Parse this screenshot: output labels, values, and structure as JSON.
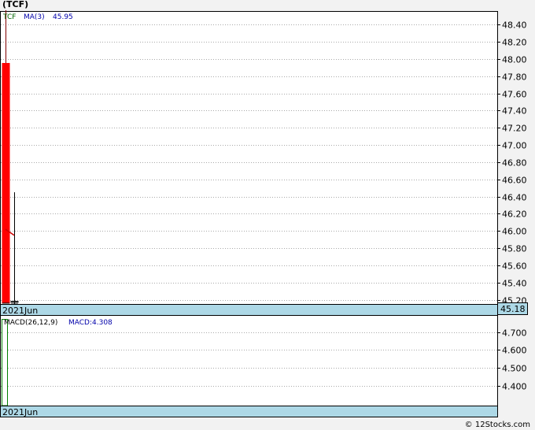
{
  "header": {
    "title": "(TCF)",
    "footer": "© 12Stocks.com"
  },
  "colors": {
    "up": "#008000",
    "down": "#ff0000",
    "ma": "#cc0000",
    "axis_band": "#add8e6",
    "legend_blue": "#0000aa",
    "legend_green": "#006400"
  },
  "chart_data": [
    {
      "type": "candlestick",
      "legend": {
        "symbol": "TCF",
        "ma_label": "MA(3)",
        "ma_value": "45.95"
      },
      "ylim": [
        45.15,
        48.55
      ],
      "yticks": [
        "48.40",
        "48.20",
        "48.00",
        "47.80",
        "47.60",
        "47.40",
        "47.20",
        "47.00",
        "46.80",
        "46.60",
        "46.40",
        "46.20",
        "46.00",
        "45.80",
        "45.60",
        "45.40",
        "45.20"
      ],
      "x_label": "2021Jun",
      "last_price": "45.18",
      "candles": [
        {
          "open": 47.95,
          "high": 48.57,
          "low": 45.16,
          "close": 45.16
        },
        {
          "open": 45.17,
          "high": 46.45,
          "low": 45.15,
          "close": 45.18
        }
      ],
      "ma": [
        46.02,
        45.95
      ]
    },
    {
      "type": "bar",
      "legend": {
        "label": "MACD(26,12,9)",
        "value_label": "MACD:4.308"
      },
      "ylim": [
        4.29,
        4.79
      ],
      "yticks": [
        "4.700",
        "4.600",
        "4.500",
        "4.400"
      ],
      "x_label": "2021Jun",
      "values": [
        4.77
      ]
    }
  ]
}
